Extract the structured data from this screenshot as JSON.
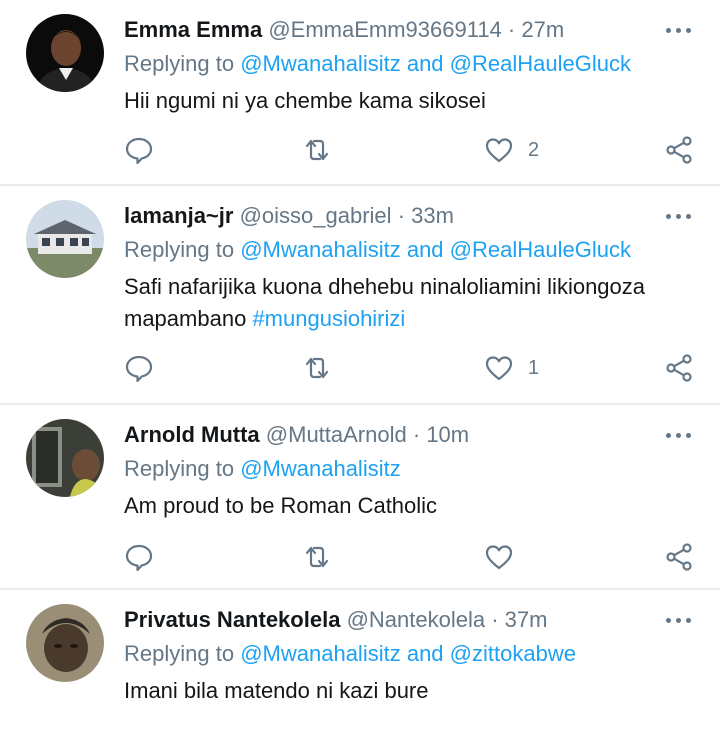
{
  "colors": {
    "link": "#1da1f2",
    "secondary": "#657786",
    "divider": "#e6ecf0"
  },
  "icons": {
    "reply": "comment-icon",
    "retweet": "retweet-icon",
    "like": "heart-icon",
    "share": "share-icon",
    "more": "more-dots-icon"
  },
  "tweets": [
    {
      "name": "Emma Emma",
      "handle": "@EmmaEmm93669114",
      "sep": "·",
      "time": "27m",
      "replying_label": "Replying to",
      "mention1": "@Mwanahalisitz",
      "and": "and",
      "mention2": "@RealHauleGluck",
      "text": "Hii ngumi ni ya chembe kama sikosei",
      "like_count": "2"
    },
    {
      "name": "lamanja~jr",
      "handle": "@oisso_gabriel",
      "sep": "·",
      "time": "33m",
      "replying_label": "Replying to",
      "mention1": "@Mwanahalisitz",
      "and": "and",
      "mention2": "@RealHauleGluck",
      "text": "Safi nafarijika kuona dhehebu ninaloliamini likiongoza mapambano",
      "hashtag": "#mungusiohirizi",
      "like_count": "1"
    },
    {
      "name": "Arnold Mutta",
      "handle": "@MuttaArnold",
      "sep": "·",
      "time": "10m",
      "replying_label": "Replying to",
      "mention1": "@Mwanahalisitz",
      "text": "Am proud to be Roman Catholic"
    },
    {
      "name": "Privatus Nantekolela",
      "handle": "@Nantekolela",
      "sep": "·",
      "time": "37m",
      "replying_label": "Replying to",
      "mention1": "@Mwanahalisitz",
      "and": "and",
      "mention2": "@zittokabwe",
      "text": "Imani bila matendo ni kazi bure"
    }
  ]
}
